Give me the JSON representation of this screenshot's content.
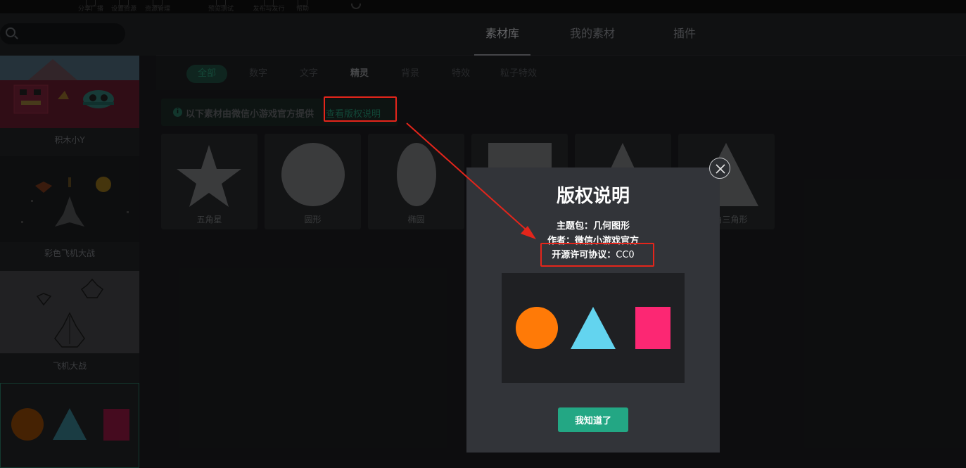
{
  "toolbar": {
    "items": [
      "分享广播",
      "设置资源",
      "资源管理",
      "预览测试",
      "发布与发行",
      "帮助"
    ]
  },
  "search": {
    "placeholder": ""
  },
  "tabs": {
    "library": "素材库",
    "mine": "我的素材",
    "plugins": "插件"
  },
  "sidebar": {
    "items": [
      {
        "label": "积木小Y"
      },
      {
        "label": "彩色飞机大战"
      },
      {
        "label": "飞机大战"
      }
    ]
  },
  "filters": {
    "all": "全部",
    "digits": "数字",
    "text": "文字",
    "sprites": "精灵",
    "backgrounds": "背景",
    "effects": "特效",
    "particles": "粒子特效"
  },
  "notice": {
    "text": "以下素材由微信小游戏官方提供",
    "link": "查看版权说明"
  },
  "assets": [
    {
      "name": "五角星"
    },
    {
      "name": "圆形"
    },
    {
      "name": "椭圆"
    },
    {
      "name": ""
    },
    {
      "name": ""
    },
    {
      "name": "直角三角形"
    }
  ],
  "modal": {
    "title": "版权说明",
    "theme_label": "主题包：",
    "theme_value": "几何图形",
    "author_label": "作者：",
    "author_value": "微信小游戏官方",
    "license_label": "开源许可协议：",
    "license_value": "CC0",
    "confirm_label": "我知道了"
  },
  "colors": {
    "accent": "#23a784",
    "highlight": "#e4251b",
    "shape_orange": "#ff7a07",
    "shape_cyan": "#63d4ef",
    "shape_pink": "#fc2773"
  },
  "icons": {
    "close": "close-icon",
    "search": "search-icon",
    "info": "info-icon"
  }
}
